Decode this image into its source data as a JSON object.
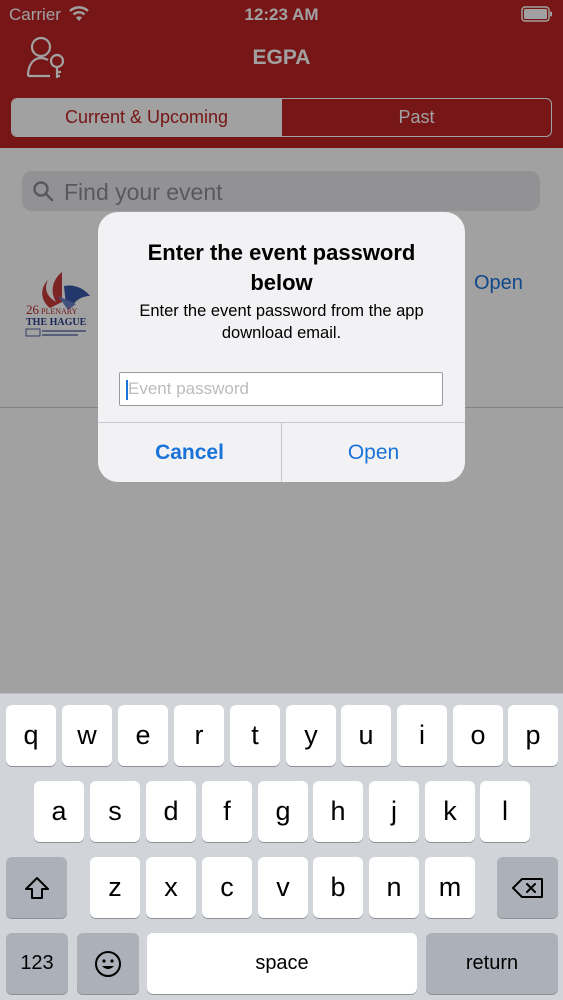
{
  "status_bar": {
    "carrier": "Carrier",
    "time": "12:23 AM"
  },
  "header": {
    "title": "EGPA",
    "tabs": [
      {
        "label": "Current & Upcoming",
        "active": true
      },
      {
        "label": "Past",
        "active": false
      }
    ]
  },
  "search": {
    "placeholder": "Find your event"
  },
  "event": {
    "open_label": "Open"
  },
  "alert": {
    "title": "Enter the event password below",
    "message": "Enter the event password from the app download email.",
    "input_placeholder": "Event password",
    "cancel_label": "Cancel",
    "open_label": "Open"
  },
  "keyboard": {
    "row1": [
      "q",
      "w",
      "e",
      "r",
      "t",
      "y",
      "u",
      "i",
      "o",
      "p"
    ],
    "row2": [
      "a",
      "s",
      "d",
      "f",
      "g",
      "h",
      "j",
      "k",
      "l"
    ],
    "row3": [
      "z",
      "x",
      "c",
      "v",
      "b",
      "n",
      "m"
    ],
    "numbers_label": "123",
    "space_label": "space",
    "return_label": "return"
  },
  "colors": {
    "brand_red": "#bd2424",
    "link_blue": "#1a73d9"
  }
}
